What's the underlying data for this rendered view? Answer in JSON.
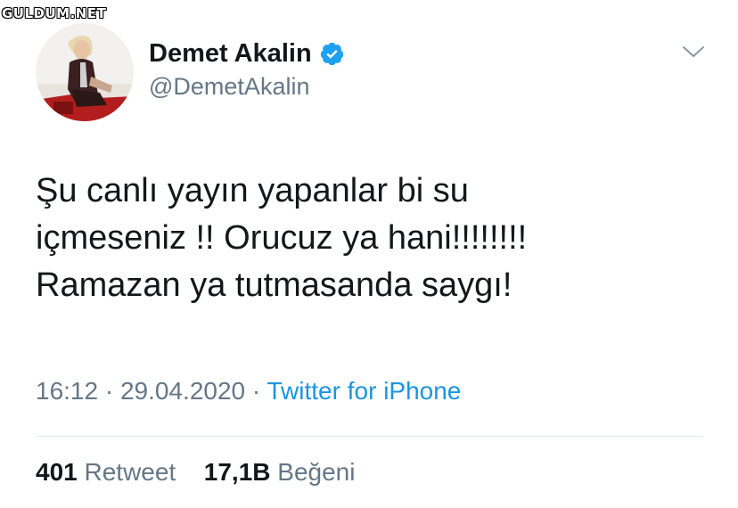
{
  "watermark": "GULDUM.NET",
  "user": {
    "display_name": "Demet Akalin",
    "handle": "@DemetAkalin",
    "verified": true
  },
  "tweet": {
    "lines": [
      "Şu canlı yayın yapanlar bi su",
      "içmeseniz !! Orucuz ya hani!!!!!!!!",
      "Ramazan ya tutmasanda saygı!"
    ],
    "time": "16:12",
    "separator": "·",
    "date": "29.04.2020",
    "source": "Twitter for iPhone"
  },
  "stats": {
    "retweets_count": "401",
    "retweets_label": "Retweet",
    "likes_count": "17,1B",
    "likes_label": "Beğeni"
  },
  "colors": {
    "text": "#14171a",
    "secondary": "#657786",
    "accent": "#1b95e0",
    "verified_badge": "#1da1f2",
    "divider": "#e1e8ed"
  },
  "icons": {
    "verified": "verified-badge-icon",
    "more": "chevron-down-icon"
  }
}
